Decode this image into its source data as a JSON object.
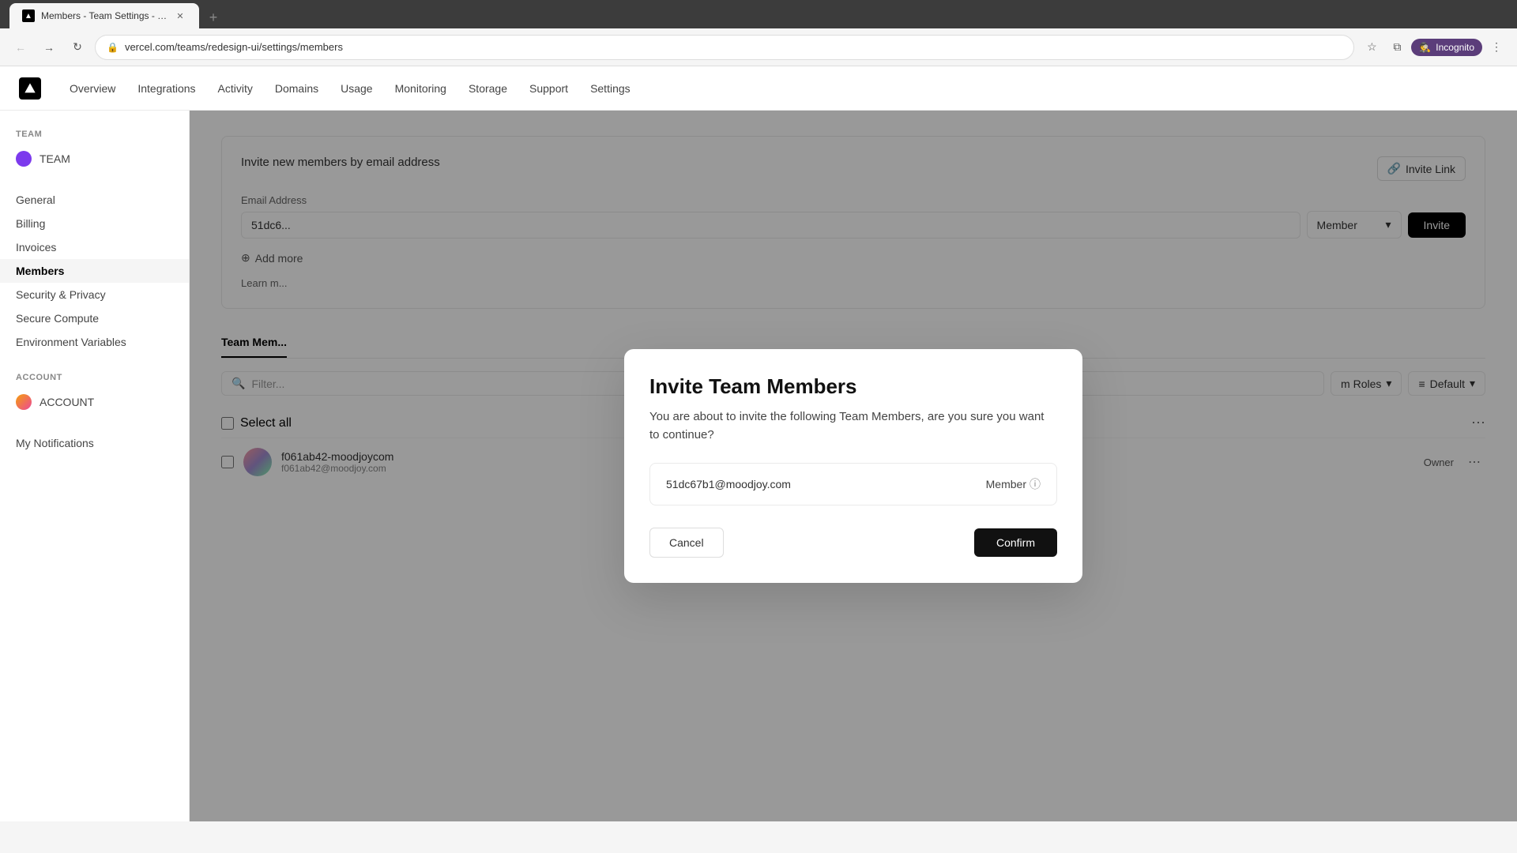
{
  "browser": {
    "tab_title": "Members - Team Settings - Da...",
    "tab_favicon": "▲",
    "url": "vercel.com/teams/redesign-ui/settings/members",
    "new_tab_icon": "+",
    "incognito_label": "Incognito"
  },
  "nav": {
    "logo_alt": "Vercel",
    "links": [
      "Overview",
      "Integrations",
      "Activity",
      "Domains",
      "Usage",
      "Monitoring",
      "Storage",
      "Support",
      "Settings"
    ]
  },
  "sidebar": {
    "team_section_label": "TEAM",
    "team_name": "TEAM",
    "team_avatar_color": "#7c3aed",
    "team_items": [
      "General",
      "Billing",
      "Invoices",
      "Members",
      "Security & Privacy",
      "Secure Compute",
      "Environment Variables"
    ],
    "active_item": "Members",
    "account_section_label": "ACCOUNT",
    "account_name": "ACCOUNT",
    "account_avatar_color": "#f59e0b",
    "account_items": [
      "My Notifications"
    ]
  },
  "content": {
    "invite_section_title": "Invite new members by email address",
    "invite_link_btn_label": "Invite Link",
    "email_address_label": "Email Address",
    "email_placeholder": "51dc6...",
    "role_placeholder": "Member",
    "add_more_label": "Add more",
    "learn_more_text": "Learn m...",
    "invite_button_label": "Invite",
    "team_members_tab": "Team Mem...",
    "filter_placeholder": "Filter...",
    "team_roles_label": "m Roles",
    "default_label": "Default",
    "select_all_label": "Select all",
    "member_name": "f061ab42-moodjoycom",
    "member_email": "f061ab42@moodjoy.com",
    "member_role": "Owner"
  },
  "modal": {
    "title": "Invite Team Members",
    "description": "You are about to invite the following Team Members, are you sure you want to continue?",
    "invite_email": "51dc67b1@moodjoy.com",
    "invite_role": "Member",
    "role_info_icon": "ⓘ",
    "cancel_label": "Cancel",
    "confirm_label": "Confirm"
  }
}
